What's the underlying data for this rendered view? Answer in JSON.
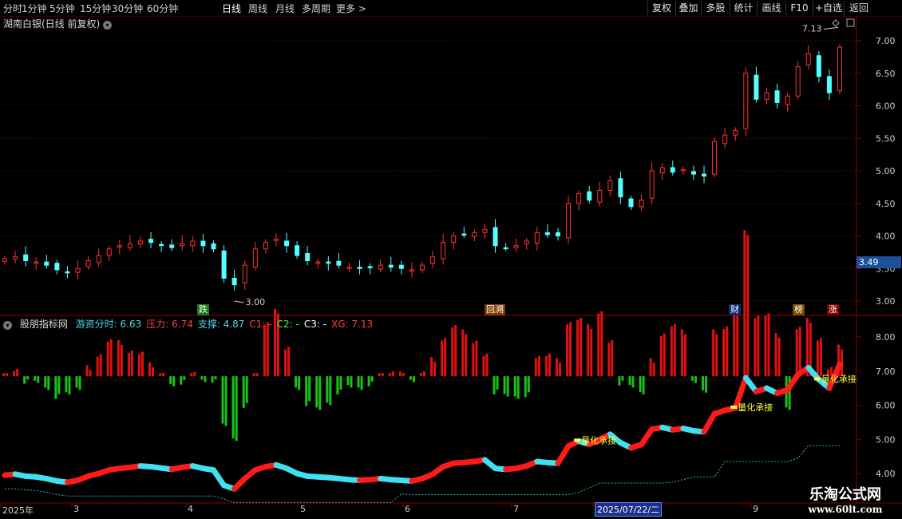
{
  "toolbar": {
    "left": [
      "分时",
      "1分钟",
      "5分钟",
      "15分钟",
      "30分钟",
      "60分钟",
      "日线",
      "周线",
      "月线",
      "多周期",
      "更多 >"
    ],
    "active": "日线",
    "right": [
      "复权",
      "叠加",
      "多股",
      "统计",
      "画线",
      "F10",
      "+自选",
      "返回"
    ]
  },
  "chart_title": "湖南白银(日线 前复权)",
  "corner_icons": [
    "diamond-icon",
    "menu-icon"
  ],
  "price_axis": {
    "ticks": [
      "7.00",
      "6.50",
      "6.00",
      "5.50",
      "5.00",
      "4.50",
      "4.00",
      "3.50",
      "3.00"
    ],
    "current": "3.49"
  },
  "annotations": {
    "high": "7.13",
    "low": "3.00"
  },
  "event_tags": [
    {
      "label": "跌",
      "color": "#1a7a1a"
    },
    {
      "label": "回溯",
      "color": "#7a3a00"
    },
    {
      "label": "财",
      "color": "#0b2a6b"
    },
    {
      "label": "榜",
      "color": "#7a4a00"
    },
    {
      "label": "涨",
      "color": "#7a0000"
    }
  ],
  "indicator": {
    "name": "股朋指标网",
    "items": [
      {
        "label": "游资分时: 6.63",
        "color": "#4fd6e6"
      },
      {
        "label": "压力: 6.74",
        "color": "#ff4040"
      },
      {
        "label": "支撑: 4.87",
        "color": "#4fd6e6"
      },
      {
        "label": "C1: -",
        "color": "#ff4040"
      },
      {
        "label": "C2: -",
        "color": "#40ff40"
      },
      {
        "label": "C3: -",
        "color": "#ffffff"
      },
      {
        "label": "XG: 7.13",
        "color": "#ff4040"
      }
    ],
    "axis_ticks": [
      "8.00",
      "7.00",
      "6.00",
      "5.00",
      "4.00"
    ],
    "signals": [
      "量化承接",
      "量化承接",
      "量化承接"
    ]
  },
  "date_axis": {
    "labels": [
      "2025年",
      "3",
      "4",
      "5",
      "6",
      "7",
      "2025/07/22/二",
      "9"
    ]
  },
  "watermark": {
    "line1": "乐淘公式网",
    "line2": "www.60lt.com"
  },
  "chart_data": {
    "type": "candlestick",
    "close_series": [
      3.65,
      3.68,
      3.62,
      3.6,
      3.55,
      3.48,
      3.44,
      3.5,
      3.62,
      3.7,
      3.8,
      3.85,
      3.88,
      3.92,
      3.9,
      3.86,
      3.82,
      3.88,
      3.92,
      3.85,
      3.8,
      3.35,
      3.25,
      3.55,
      3.8,
      3.9,
      3.95,
      3.85,
      3.7,
      3.62,
      3.6,
      3.58,
      3.55,
      3.52,
      3.5,
      3.52,
      3.55,
      3.52,
      3.5,
      3.48,
      3.55,
      3.68,
      3.9,
      4.0,
      4.02,
      4.05,
      4.1,
      3.85,
      3.82,
      3.85,
      3.92,
      4.05,
      4.02,
      4.0,
      4.5,
      4.65,
      4.55,
      4.7,
      4.85,
      4.6,
      4.45,
      4.55,
      5.0,
      5.05,
      4.98,
      5.02,
      4.95,
      4.92,
      5.45,
      5.55,
      5.62,
      6.5,
      6.1,
      6.2,
      6.05,
      6.15,
      6.6,
      6.8,
      6.45,
      6.2,
      6.9
    ],
    "pressure": 6.74,
    "support": 4.87,
    "high": 7.13,
    "low": 3.0
  }
}
